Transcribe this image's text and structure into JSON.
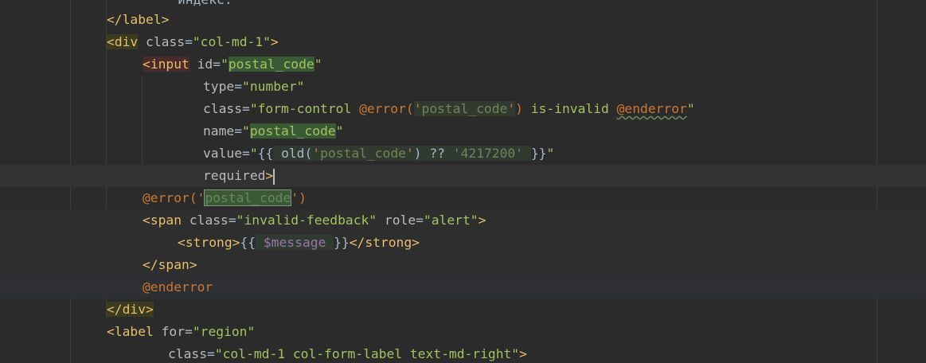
{
  "editor": {
    "lines": {
      "l0": {
        "text": "индекс:"
      },
      "l1": {
        "open": "</",
        "name": "label",
        "close": ">"
      },
      "l2": {
        "open": "<",
        "name": "div",
        "attr": " class",
        "eq": "=",
        "val": "\"col-md-1\"",
        "close": ">"
      },
      "l3": {
        "open": "<",
        "name": "input",
        "attr": " id",
        "eq": "=",
        "q1": "\"",
        "val": "postal_code",
        "q2": "\""
      },
      "l4": {
        "attr": "type",
        "eq": "=",
        "val": "\"number\""
      },
      "l5": {
        "attr": "class",
        "eq": "=",
        "q1": "\"form-control ",
        "dir1": "@error",
        "paren1": "(",
        "sq1": "'",
        "arg": "postal_code",
        "sq2": "'",
        "paren2": ")",
        "mid": " is-invalid ",
        "dir2": "@enderror",
        "q2": "\""
      },
      "l6": {
        "attr": "name",
        "eq": "=",
        "q1": "\"",
        "val": "postal_code",
        "q2": "\""
      },
      "l7": {
        "attr": "value",
        "eq": "=",
        "q1": "\"",
        "echo_open": "{{",
        "sp1": " ",
        "fn": "old",
        "paren1": "(",
        "sq1": "'",
        "arg": "postal_code",
        "sq2": "'",
        "paren2": ")",
        "op": " ?? ",
        "default": "'4217200'",
        "sp2": " ",
        "echo_close": "}}",
        "q2": "\""
      },
      "l8": {
        "attr": "required",
        "close": ">"
      },
      "l9": {
        "dir": "@error",
        "paren1": "(",
        "sq1": "'",
        "arg": "postal_code",
        "sq2": "'",
        "paren2": ")"
      },
      "l10": {
        "open": "<",
        "name": "span",
        "attr1": " class",
        "eq1": "=",
        "val1": "\"invalid-feedback\"",
        "attr2": " role",
        "eq2": "=",
        "val2": "\"alert\"",
        "close": ">"
      },
      "l11": {
        "open": "<",
        "name": "strong",
        "close": ">",
        "echo_open": "{{",
        "sp1": " ",
        "var": "$message",
        "sp2": " ",
        "echo_close": "}}",
        "end_open": "</",
        "end_name": "strong",
        "end_close": ">"
      },
      "l12": {
        "open": "</",
        "name": "span",
        "close": ">"
      },
      "l13": {
        "dir": "@enderror"
      },
      "l14": {
        "open": "</",
        "name": "div",
        "close": ">"
      },
      "l15": {
        "open": "<",
        "name": "label",
        "attr": " for",
        "eq": "=",
        "val": "\"region\""
      },
      "l16": {
        "attr": "class",
        "eq": "=",
        "val": "\"col-md-1 col-form-label text-md-right\"",
        "close": ">"
      }
    }
  }
}
